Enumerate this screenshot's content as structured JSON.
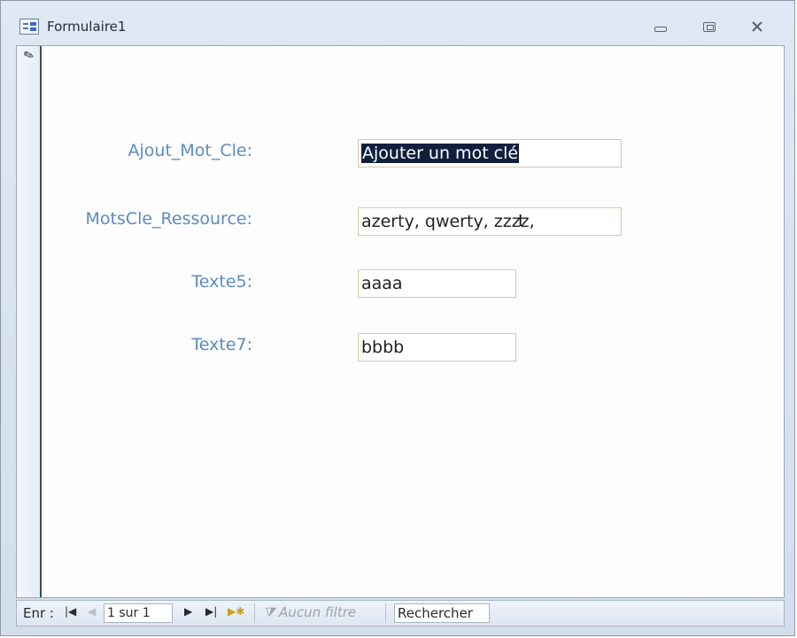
{
  "window": {
    "title": "Formulaire1",
    "controls": {
      "minimize": "minimize-icon",
      "maximize": "maximize-icon",
      "close": "close-icon"
    }
  },
  "form": {
    "fields": [
      {
        "label": "Ajout_Mot_Cle:",
        "value": "Ajouter un mot clé",
        "selected": true
      },
      {
        "label": "MotsCle_Ressource:",
        "value": "azerty, qwerty, zzzz,"
      },
      {
        "label": "Texte5:",
        "value": "aaaa"
      },
      {
        "label": "Texte7:",
        "value": "bbbb"
      }
    ]
  },
  "navbar": {
    "record_label": "Enr :",
    "record_value": "1 sur 1",
    "filter_label": "Aucun filtre",
    "search_value": "Rechercher"
  },
  "colors": {
    "label": "#5b8cc0",
    "selection": "#0f1f3d",
    "frame": "#d2deec"
  }
}
